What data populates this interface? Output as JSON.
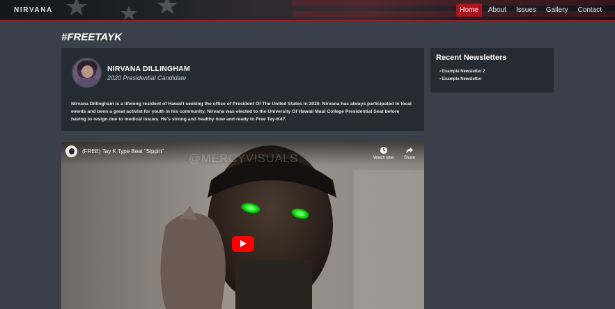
{
  "brand": "NIRVANA",
  "nav": {
    "items": [
      "Home",
      "About",
      "Issues",
      "Gallery",
      "Contact"
    ],
    "active": "Home"
  },
  "page": {
    "title": "#FREETAYK"
  },
  "profile": {
    "name": "NIRVANA DILLINGHAM",
    "subtitle": "2020 Presidential Candidate",
    "bio": "Nirvana Dillingham is a lifelong resident of Hawai'i seeking the office of President Of The United States in 2020. Nirvana has always participated in local events and been a great activist for youth in his community. Nirvana was elected to the University Of Hawaii Maui College Presidential Seat before having to resign due to medical issues. He's strong and healthy now and ready to Free Tay-K47."
  },
  "sidebar": {
    "title": "Recent Newsletters",
    "items": [
      "Example Newsletter 2",
      "Example Newsletter"
    ]
  },
  "video": {
    "title": "(FREE) Tay K Type Beat \"Sippin\"",
    "watermark": "@MERCYVISUALS",
    "watch_later_label": "Watch later",
    "share_label": "Share"
  },
  "colors": {
    "accent": "#a8151f",
    "background": "#3a4049",
    "card": "#252b32",
    "play_button": "#ff0000",
    "eye_glow": "#22ff22"
  },
  "icons": {
    "watch_later": "clock-icon",
    "share": "share-arrow-icon",
    "play": "play-icon"
  }
}
